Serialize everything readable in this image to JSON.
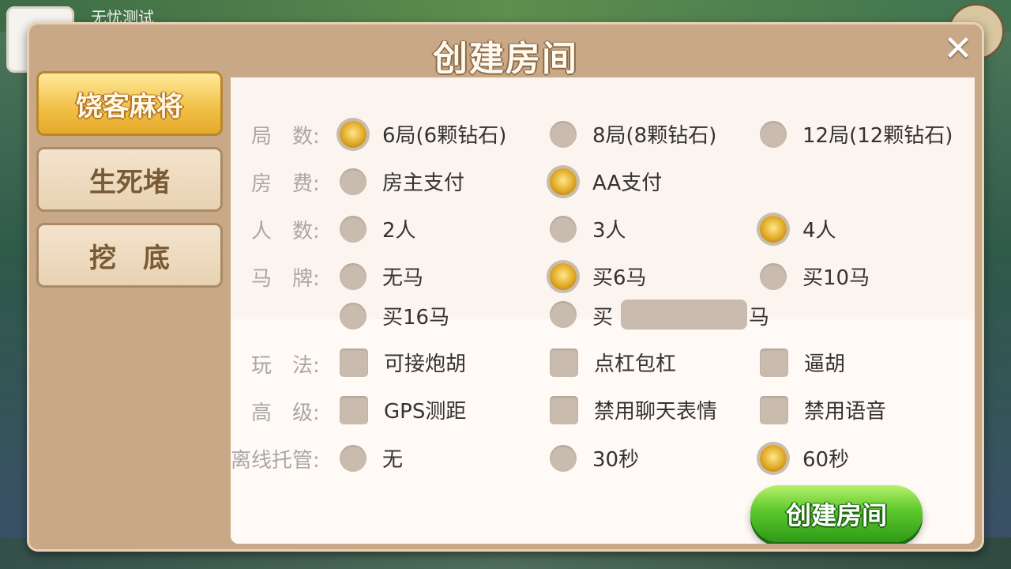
{
  "background": {
    "user_name": "无忧测试"
  },
  "dialog": {
    "title": "创建房间",
    "close_glyph": "✕"
  },
  "tabs": [
    {
      "label": "饶客麻将",
      "active": true
    },
    {
      "label": "生死堵",
      "active": false
    },
    {
      "label": "挖　底",
      "active": false
    }
  ],
  "settings": {
    "rounds": {
      "label": "局　数:",
      "options": [
        {
          "label": "6局(6颗钻石)",
          "selected": true
        },
        {
          "label": "8局(8颗钻石)",
          "selected": false
        },
        {
          "label": "12局(12颗钻石)",
          "selected": false
        }
      ]
    },
    "fee": {
      "label": "房　费:",
      "options": [
        {
          "label": "房主支付",
          "selected": false
        },
        {
          "label": "AA支付",
          "selected": true
        }
      ]
    },
    "players": {
      "label": "人　数:",
      "options": [
        {
          "label": "2人",
          "selected": false
        },
        {
          "label": "3人",
          "selected": false
        },
        {
          "label": "4人",
          "selected": true
        }
      ]
    },
    "horse": {
      "label": "马　牌:",
      "options": [
        {
          "label": "无马",
          "selected": false
        },
        {
          "label": "买6马",
          "selected": true
        },
        {
          "label": "买10马",
          "selected": false
        },
        {
          "label": "买16马",
          "selected": false
        }
      ],
      "custom": {
        "prefix": "买",
        "suffix": "马",
        "value": ""
      }
    },
    "play": {
      "label": "玩　法:",
      "options": [
        {
          "label": "可接炮胡",
          "checked": false
        },
        {
          "label": "点杠包杠",
          "checked": false
        },
        {
          "label": "逼胡",
          "checked": false
        }
      ]
    },
    "advanced": {
      "label": "高　级:",
      "options": [
        {
          "label": "GPS测距",
          "checked": false
        },
        {
          "label": "禁用聊天表情",
          "checked": false
        },
        {
          "label": "禁用语音",
          "checked": false
        }
      ]
    },
    "offline": {
      "label": "离线托管:",
      "options": [
        {
          "label": "无",
          "selected": false
        },
        {
          "label": "30秒",
          "selected": false
        },
        {
          "label": "60秒",
          "selected": true
        }
      ]
    }
  },
  "create_button": "创建房间"
}
